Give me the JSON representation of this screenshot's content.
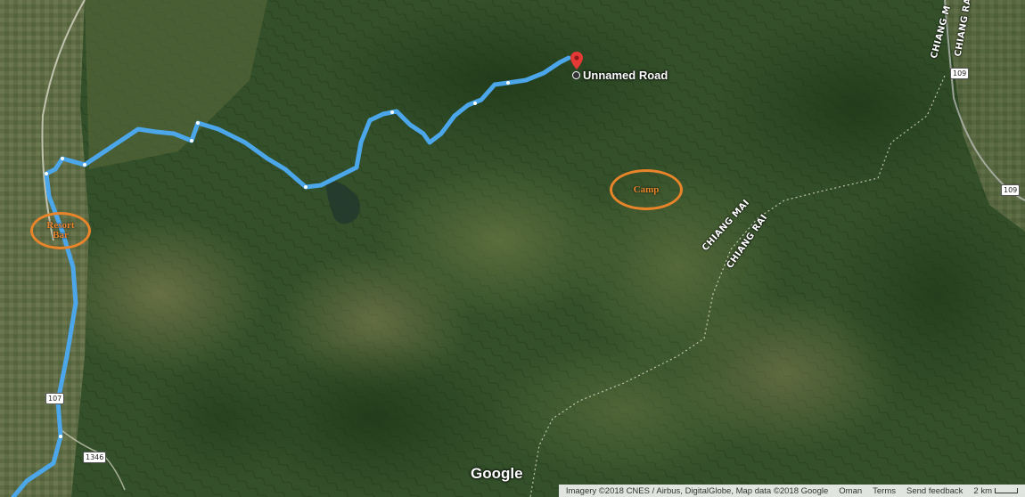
{
  "map": {
    "destination_label": "Unnamed Road",
    "google_logo": "Google",
    "markers": {
      "destination": "red-pin-icon",
      "poi": "circle-icon"
    },
    "colors": {
      "route": "#4ca6ea",
      "annotation": "#e8842a",
      "pin": "#e53935",
      "terrain_dark": "#2e4a22",
      "terrain_light": "#5a6e3a"
    },
    "road_labels": {
      "chiang_mai": "CHIANG MAI",
      "chiang_rai": "CHIANG RAI",
      "chiang_m_top": "CHIANG M",
      "chiang_ra_top": "CHIANG RA"
    },
    "road_shields": {
      "r107": "107",
      "r1346": "1346",
      "r109_top": "109",
      "r109_right": "109"
    },
    "annotations": {
      "camp": "Camp",
      "resort_line1": "Resort",
      "resort_line2": "Bar"
    }
  },
  "footer": {
    "attribution": "Imagery ©2018 CNES / Airbus, DigitalGlobe, Map data ©2018 Google",
    "country": "Oman",
    "terms": "Terms",
    "feedback": "Send feedback",
    "scale": "2 km"
  }
}
